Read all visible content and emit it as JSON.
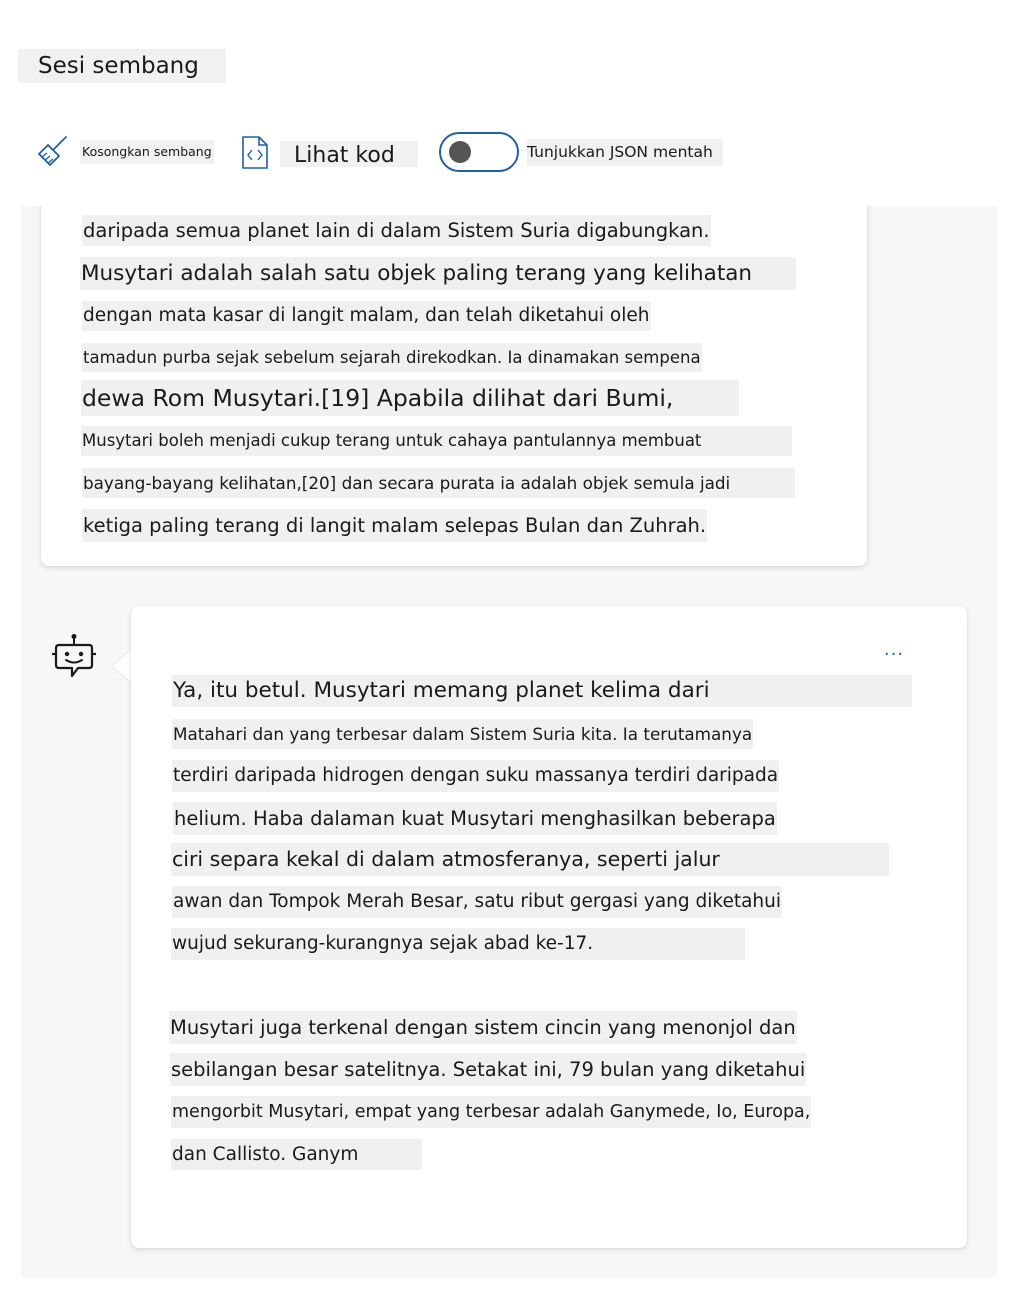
{
  "header": {
    "title": "Sesi sembang"
  },
  "toolbar": {
    "clear_label": "Kosongkan sembang",
    "view_code_label": "Lihat kod",
    "show_json_label": "Tunjukkan JSON mentah",
    "show_json_enabled": false
  },
  "user_message": {
    "lines": [
      "daripada semua planet lain di dalam Sistem Suria digabungkan.",
      "Musytari adalah salah satu objek paling terang yang kelihatan",
      "dengan mata kasar di langit malam, dan telah diketahui oleh",
      "tamadun purba sejak sebelum sejarah direkodkan. Ia dinamakan sempena",
      "dewa Rom Musytari.[19] Apabila dilihat dari Bumi,",
      "Musytari boleh menjadi cukup terang untuk cahaya pantulannya membuat",
      "bayang-bayang kelihatan,[20] dan secara purata ia adalah objek semula jadi",
      "ketiga paling terang di langit malam selepas Bulan dan Zuhrah."
    ]
  },
  "assistant_message": {
    "more_label": "...",
    "lines": [
      "Ya, itu betul. Musytari memang planet kelima dari",
      "Matahari dan yang terbesar dalam Sistem Suria kita. Ia terutamanya",
      "terdiri daripada hidrogen dengan suku massanya terdiri daripada",
      "helium. Haba dalaman kuat Musytari menghasilkan beberapa",
      "ciri separa kekal di dalam atmosferanya, seperti jalur",
      "awan dan Tompok Merah Besar, satu ribut gergasi yang diketahui",
      "wujud sekurang-kurangnya sejak abad ke-17.",
      "Musytari juga terkenal dengan sistem cincin yang menonjol dan",
      "sebilangan besar satelitnya. Setakat ini, 79 bulan yang diketahui",
      "mengorbit Musytari, empat yang terbesar adalah Ganymede, Io, Europa,",
      "dan Callisto. Ganym"
    ]
  },
  "icons": {
    "clear": "broom-icon",
    "code": "code-file-icon",
    "bot": "bot-icon"
  },
  "colors": {
    "accent": "#1e5faa",
    "text_highlight": "#f0f0f0",
    "chat_background": "#f7f7f7"
  }
}
